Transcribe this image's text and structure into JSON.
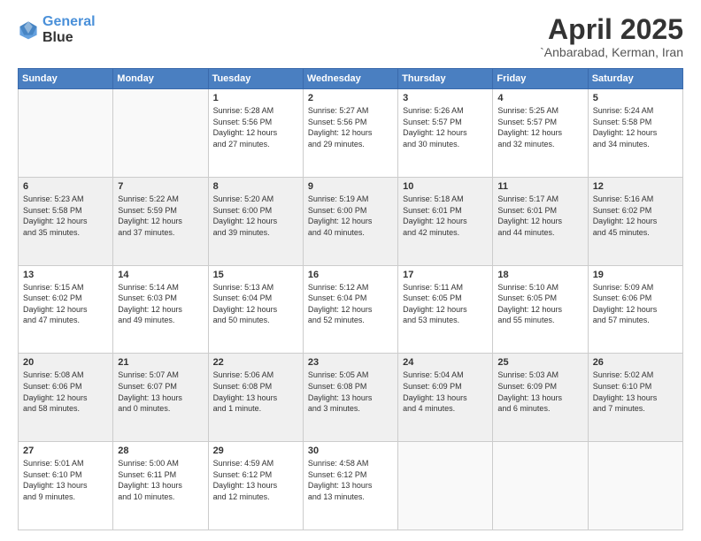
{
  "logo": {
    "line1": "General",
    "line2": "Blue"
  },
  "title": "April 2025",
  "subtitle": "`Anbarabad, Kerman, Iran",
  "headers": [
    "Sunday",
    "Monday",
    "Tuesday",
    "Wednesday",
    "Thursday",
    "Friday",
    "Saturday"
  ],
  "weeks": [
    [
      {
        "day": "",
        "info": ""
      },
      {
        "day": "",
        "info": ""
      },
      {
        "day": "1",
        "info": "Sunrise: 5:28 AM\nSunset: 5:56 PM\nDaylight: 12 hours\nand 27 minutes."
      },
      {
        "day": "2",
        "info": "Sunrise: 5:27 AM\nSunset: 5:56 PM\nDaylight: 12 hours\nand 29 minutes."
      },
      {
        "day": "3",
        "info": "Sunrise: 5:26 AM\nSunset: 5:57 PM\nDaylight: 12 hours\nand 30 minutes."
      },
      {
        "day": "4",
        "info": "Sunrise: 5:25 AM\nSunset: 5:57 PM\nDaylight: 12 hours\nand 32 minutes."
      },
      {
        "day": "5",
        "info": "Sunrise: 5:24 AM\nSunset: 5:58 PM\nDaylight: 12 hours\nand 34 minutes."
      }
    ],
    [
      {
        "day": "6",
        "info": "Sunrise: 5:23 AM\nSunset: 5:58 PM\nDaylight: 12 hours\nand 35 minutes."
      },
      {
        "day": "7",
        "info": "Sunrise: 5:22 AM\nSunset: 5:59 PM\nDaylight: 12 hours\nand 37 minutes."
      },
      {
        "day": "8",
        "info": "Sunrise: 5:20 AM\nSunset: 6:00 PM\nDaylight: 12 hours\nand 39 minutes."
      },
      {
        "day": "9",
        "info": "Sunrise: 5:19 AM\nSunset: 6:00 PM\nDaylight: 12 hours\nand 40 minutes."
      },
      {
        "day": "10",
        "info": "Sunrise: 5:18 AM\nSunset: 6:01 PM\nDaylight: 12 hours\nand 42 minutes."
      },
      {
        "day": "11",
        "info": "Sunrise: 5:17 AM\nSunset: 6:01 PM\nDaylight: 12 hours\nand 44 minutes."
      },
      {
        "day": "12",
        "info": "Sunrise: 5:16 AM\nSunset: 6:02 PM\nDaylight: 12 hours\nand 45 minutes."
      }
    ],
    [
      {
        "day": "13",
        "info": "Sunrise: 5:15 AM\nSunset: 6:02 PM\nDaylight: 12 hours\nand 47 minutes."
      },
      {
        "day": "14",
        "info": "Sunrise: 5:14 AM\nSunset: 6:03 PM\nDaylight: 12 hours\nand 49 minutes."
      },
      {
        "day": "15",
        "info": "Sunrise: 5:13 AM\nSunset: 6:04 PM\nDaylight: 12 hours\nand 50 minutes."
      },
      {
        "day": "16",
        "info": "Sunrise: 5:12 AM\nSunset: 6:04 PM\nDaylight: 12 hours\nand 52 minutes."
      },
      {
        "day": "17",
        "info": "Sunrise: 5:11 AM\nSunset: 6:05 PM\nDaylight: 12 hours\nand 53 minutes."
      },
      {
        "day": "18",
        "info": "Sunrise: 5:10 AM\nSunset: 6:05 PM\nDaylight: 12 hours\nand 55 minutes."
      },
      {
        "day": "19",
        "info": "Sunrise: 5:09 AM\nSunset: 6:06 PM\nDaylight: 12 hours\nand 57 minutes."
      }
    ],
    [
      {
        "day": "20",
        "info": "Sunrise: 5:08 AM\nSunset: 6:06 PM\nDaylight: 12 hours\nand 58 minutes."
      },
      {
        "day": "21",
        "info": "Sunrise: 5:07 AM\nSunset: 6:07 PM\nDaylight: 13 hours\nand 0 minutes."
      },
      {
        "day": "22",
        "info": "Sunrise: 5:06 AM\nSunset: 6:08 PM\nDaylight: 13 hours\nand 1 minute."
      },
      {
        "day": "23",
        "info": "Sunrise: 5:05 AM\nSunset: 6:08 PM\nDaylight: 13 hours\nand 3 minutes."
      },
      {
        "day": "24",
        "info": "Sunrise: 5:04 AM\nSunset: 6:09 PM\nDaylight: 13 hours\nand 4 minutes."
      },
      {
        "day": "25",
        "info": "Sunrise: 5:03 AM\nSunset: 6:09 PM\nDaylight: 13 hours\nand 6 minutes."
      },
      {
        "day": "26",
        "info": "Sunrise: 5:02 AM\nSunset: 6:10 PM\nDaylight: 13 hours\nand 7 minutes."
      }
    ],
    [
      {
        "day": "27",
        "info": "Sunrise: 5:01 AM\nSunset: 6:10 PM\nDaylight: 13 hours\nand 9 minutes."
      },
      {
        "day": "28",
        "info": "Sunrise: 5:00 AM\nSunset: 6:11 PM\nDaylight: 13 hours\nand 10 minutes."
      },
      {
        "day": "29",
        "info": "Sunrise: 4:59 AM\nSunset: 6:12 PM\nDaylight: 13 hours\nand 12 minutes."
      },
      {
        "day": "30",
        "info": "Sunrise: 4:58 AM\nSunset: 6:12 PM\nDaylight: 13 hours\nand 13 minutes."
      },
      {
        "day": "",
        "info": ""
      },
      {
        "day": "",
        "info": ""
      },
      {
        "day": "",
        "info": ""
      }
    ]
  ]
}
